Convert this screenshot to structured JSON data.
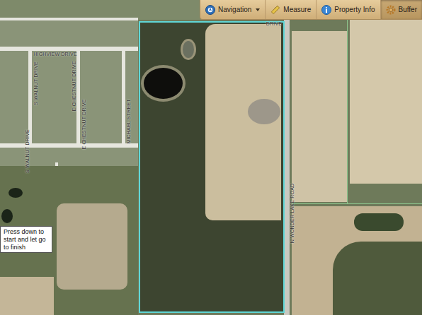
{
  "toolbar": {
    "buttons": [
      {
        "label": "Navigation",
        "selected": false,
        "dropdown": true,
        "kind": "navigation"
      },
      {
        "label": "Measure",
        "selected": false,
        "dropdown": false,
        "kind": "measure"
      },
      {
        "label": "Property Info",
        "selected": false,
        "dropdown": false,
        "kind": "info"
      },
      {
        "label": "Buffer",
        "selected": true,
        "dropdown": false,
        "kind": "buffer"
      }
    ]
  },
  "map": {
    "labels": [
      {
        "text": "HIGHVIEW DRIVE",
        "kind": "horizontal"
      },
      {
        "text": "S WALNUT DRIVE",
        "kind": "vertical"
      },
      {
        "text": "S WALNUT DRIVE",
        "kind": "vertical"
      },
      {
        "text": "E CHESTNUT DRIVE",
        "kind": "vertical"
      },
      {
        "text": "E CHESTNUT DRIVE",
        "kind": "vertical"
      },
      {
        "text": "MICHAEL STREET",
        "kind": "vertical"
      },
      {
        "text": "N WONDER LAKE ROAD",
        "kind": "vertical"
      },
      {
        "text": "DRIVE",
        "kind": "horizontal"
      }
    ]
  },
  "tooltip": {
    "text": "Press down to start and let go to finish"
  }
}
